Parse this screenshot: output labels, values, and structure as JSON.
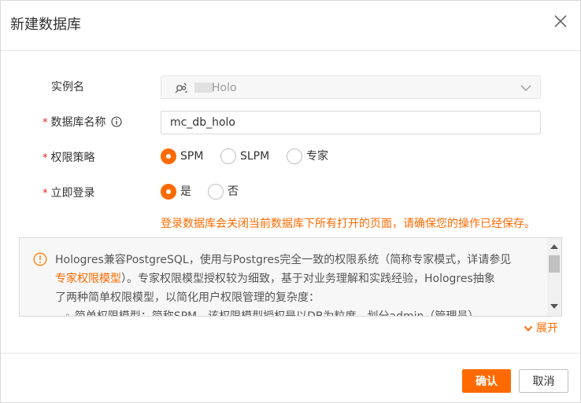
{
  "dialog": {
    "title": "新建数据库"
  },
  "form": {
    "instance": {
      "label": "实例名",
      "value": "Holo"
    },
    "db_name": {
      "required_mark": "*",
      "label": "数据库名称",
      "value": "mc_db_holo"
    },
    "policy": {
      "required_mark": "*",
      "label": "权限策略",
      "options": [
        "SPM",
        "SLPM",
        "专家"
      ],
      "selected": "SPM"
    },
    "login": {
      "required_mark": "*",
      "label": "立即登录",
      "options": [
        "是",
        "否"
      ],
      "selected": "是"
    },
    "warning": "登录数据库会关闭当前数据库下所有打开的页面，请确保您的操作已经保存。"
  },
  "notice": {
    "line1": "Hologres兼容PostgreSQL，使用与Postgres完全一致的权限系统（简称专家模式，详请参见",
    "link": "专家权限模型",
    "line2_rest": "）。专家权限模型授权较为细致，基于对业务理解和实践经验，Hologres抽象",
    "line3": "了两种简单权限模型，以简化用户权限管理的复杂度：",
    "bullet1": "◦ 简单权限模型：简称SPM，该权限模型授权是以DB为粒度，划分admin（管理员）"
  },
  "expand_label": "展开",
  "buttons": {
    "confirm": "确认",
    "cancel": "取消"
  },
  "colors": {
    "accent": "#ff6a00",
    "required": "#e2231a"
  }
}
